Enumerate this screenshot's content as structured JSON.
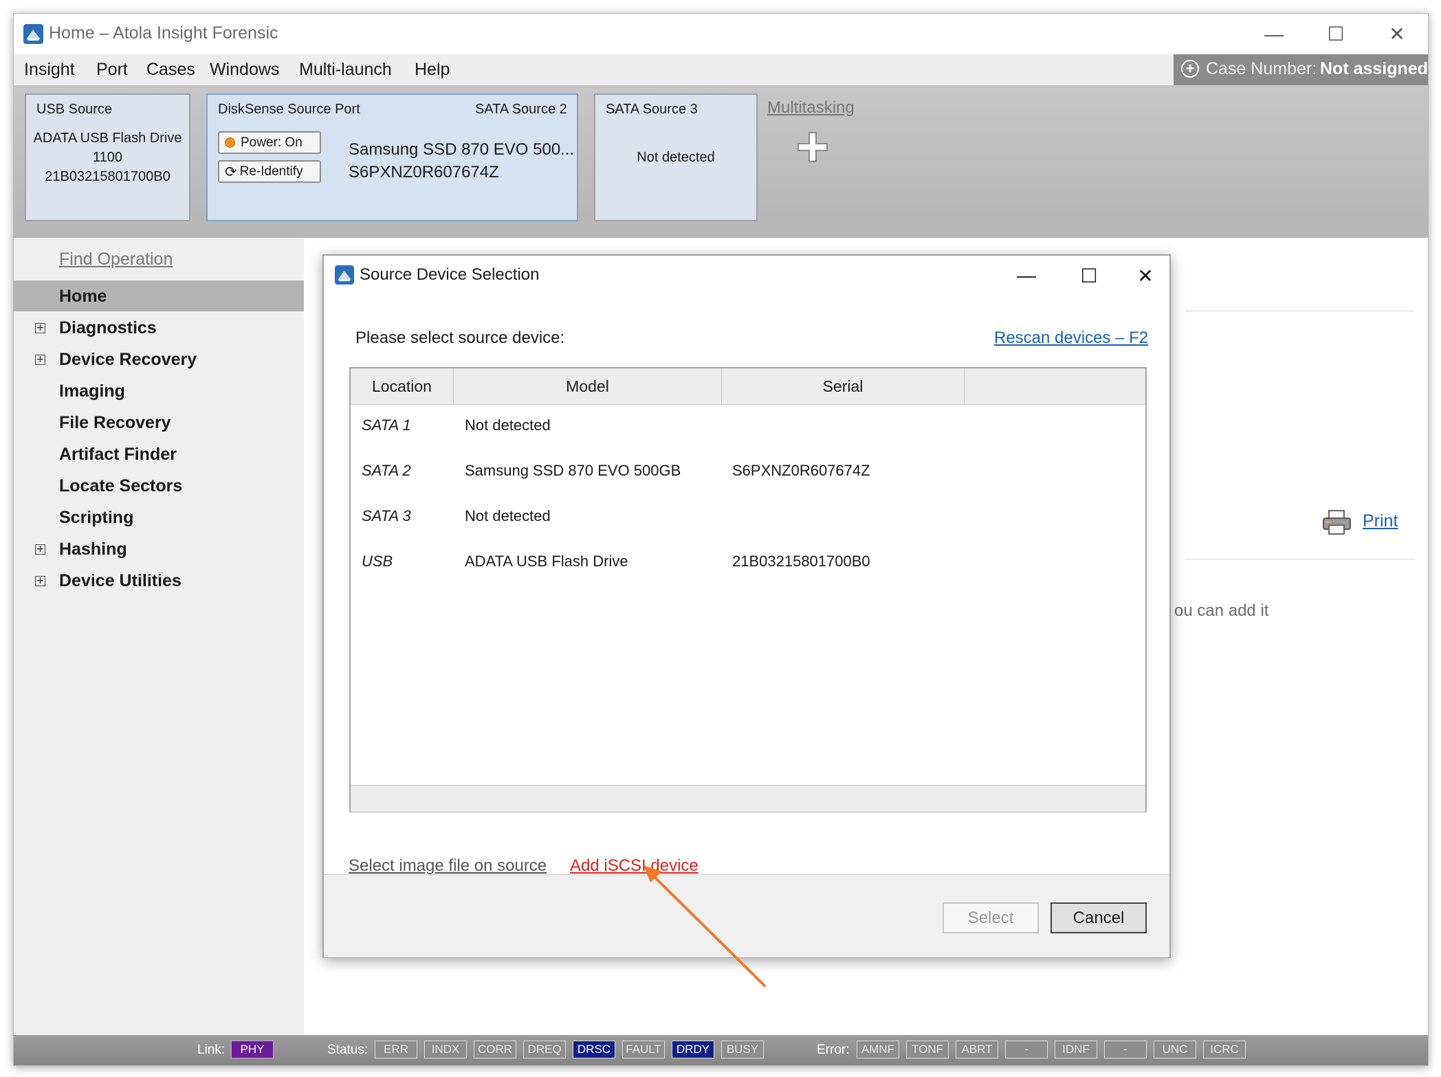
{
  "window": {
    "title": "Home – Atola Insight Forensic",
    "controls": {
      "minimize": "—",
      "maximize": "☐",
      "close": "✕"
    }
  },
  "menu": {
    "items": [
      "Insight",
      "Port",
      "Cases",
      "Windows",
      "Multi-launch",
      "Help"
    ],
    "case_number_label": "Case Number:",
    "case_number_value": "Not assigned"
  },
  "sources": {
    "usb": {
      "header": "USB Source",
      "model": "ADATA USB Flash Drive",
      "revision": "1100",
      "serial": "21B03215801700B0"
    },
    "disksense": {
      "header": "DiskSense Source Port",
      "port": "SATA Source 2",
      "power_button": "Power: On",
      "reidentify_button": "Re-Identify",
      "model": "Samsung SSD 870 EVO 500...",
      "serial": "S6PXNZ0R607674Z",
      "power_color": "#f0901e"
    },
    "sata3": {
      "header": "SATA Source 3",
      "status": "Not detected"
    },
    "multitasking_link": "Multitasking",
    "add_icon": "plus-icon"
  },
  "sidebar": {
    "find_operation": "Find Operation",
    "items": [
      {
        "label": "Home",
        "expandable": false,
        "selected": true
      },
      {
        "label": "Diagnostics",
        "expandable": true
      },
      {
        "label": "Device Recovery",
        "expandable": true
      },
      {
        "label": "Imaging",
        "expandable": false
      },
      {
        "label": "File Recovery",
        "expandable": false
      },
      {
        "label": "Artifact Finder",
        "expandable": false
      },
      {
        "label": "Locate Sectors",
        "expandable": false
      },
      {
        "label": "Scripting",
        "expandable": false
      },
      {
        "label": "Hashing",
        "expandable": true
      },
      {
        "label": "Device Utilities",
        "expandable": true
      }
    ]
  },
  "content": {
    "print_link": "Print",
    "hint_text": "ou can add it"
  },
  "dialog": {
    "title": "Source Device Selection",
    "prompt": "Please select source device:",
    "rescan_link": "Rescan devices – F2",
    "columns": [
      "Location",
      "Model",
      "Serial"
    ],
    "rows": [
      {
        "location": "SATA 1",
        "model": "Not detected",
        "serial": ""
      },
      {
        "location": "SATA 2",
        "model": "Samsung SSD 870 EVO 500GB",
        "serial": "S6PXNZ0R607674Z"
      },
      {
        "location": "SATA 3",
        "model": "Not detected",
        "serial": ""
      },
      {
        "location": "USB",
        "model": "ADATA USB Flash Drive",
        "serial": "21B03215801700B0"
      }
    ],
    "select_image_link": "Select image file on source",
    "add_iscsi_link": "Add iSCSI device",
    "select_button": "Select",
    "cancel_button": "Cancel",
    "annotation_arrow_color": "#f07a2a"
  },
  "statusbar": {
    "link_label": "Link:",
    "link_value": "PHY",
    "status_label": "Status:",
    "status_flags": [
      {
        "name": "ERR",
        "active": false
      },
      {
        "name": "INDX",
        "active": false
      },
      {
        "name": "CORR",
        "active": false
      },
      {
        "name": "DREQ",
        "active": false
      },
      {
        "name": "DRSC",
        "active": true
      },
      {
        "name": "FAULT",
        "active": false
      },
      {
        "name": "DRDY",
        "active": true
      },
      {
        "name": "BUSY",
        "active": false
      }
    ],
    "error_label": "Error:",
    "error_flags": [
      "AMNF",
      "TONF",
      "ABRT",
      "-",
      "IDNF",
      "-",
      "UNC",
      "ICRC"
    ],
    "colors": {
      "phy": "#6a1b9a",
      "active_flag": "#0f1f8a"
    }
  }
}
